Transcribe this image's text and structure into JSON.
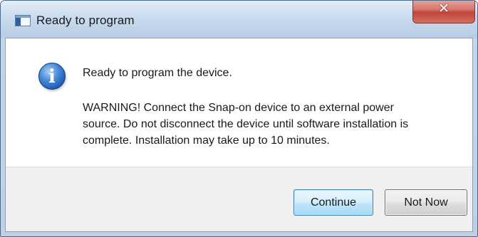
{
  "window": {
    "title": "Ready to program",
    "close_glyph": "✕",
    "icons": {
      "app": "application-icon",
      "close": "close-icon"
    }
  },
  "message": {
    "icon": "information-icon",
    "icon_glyph": "i",
    "heading": "Ready to program the device.",
    "body_lines": [
      "WARNING! Connect the Snap-on device to an external power",
      "source. Do not disconnect the device until software installation is",
      "complete. Installation may take up to 10 minutes."
    ]
  },
  "buttons": {
    "continue_label": "Continue",
    "not_now_label": "Not Now"
  },
  "colors": {
    "title_bar": "#c9dbee",
    "close_button": "#c0453b",
    "info_icon": "#1f5cb3",
    "default_button_border": "#3c7fb1"
  }
}
